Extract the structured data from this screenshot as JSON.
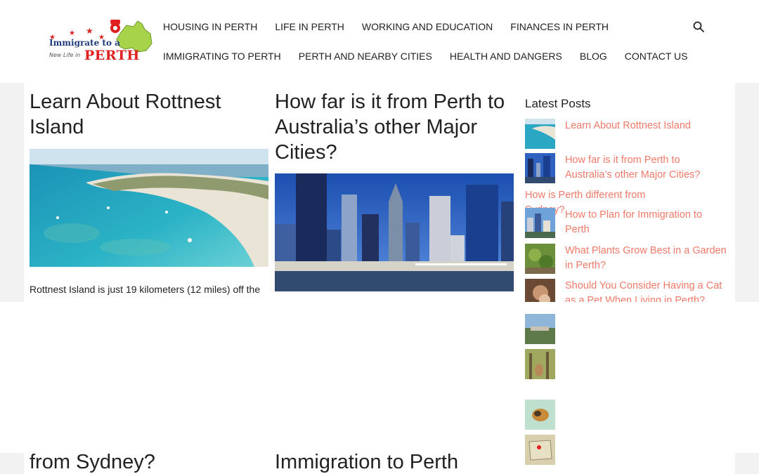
{
  "header": {
    "logo": {
      "line1": "Immigrate to a",
      "line2": "New Life in",
      "perth": "PERTH"
    },
    "nav_row1": [
      "HOUSING IN PERTH",
      "LIFE IN PERTH",
      "WORKING AND EDUCATION",
      "FINANCES IN PERTH"
    ],
    "nav_row2": [
      "IMMIGRATING TO PERTH",
      "PERTH AND NEARBY CITIES",
      "HEALTH AND DANGERS",
      "BLOG",
      "CONTACT US"
    ],
    "search_icon": "search-icon"
  },
  "articles": [
    {
      "title": "Learn About Rottnest Island",
      "excerpt": "Rottnest Island is just 19 kilometers (12 miles) off the",
      "image": "rottnest-island-aerial"
    },
    {
      "title": "How far is it from Perth to Australia’s other Major Cities?",
      "image": "perth-skyline"
    }
  ],
  "bottom_titles": [
    "from Sydney?",
    "Immigration to Perth"
  ],
  "sidebar": {
    "heading": "Latest Posts",
    "posts": [
      {
        "title": "Learn About Rottnest Island",
        "thumb": "rottnest-thumb"
      },
      {
        "title": "How far is it from Perth to Australia’s other Major Cities?",
        "thumb": "skyline-thumb"
      },
      {
        "title": "How is Perth different from Sydney?",
        "thumb": ""
      },
      {
        "title": "How to Plan for Immigration to Perth",
        "thumb": "city-thumb"
      },
      {
        "title": "What Plants Grow Best in a Garden in Perth?",
        "thumb": "garden-thumb"
      },
      {
        "title": "Should You Consider Having a Cat as a Pet When Living in Perth?",
        "thumb": "cat-thumb"
      }
    ]
  },
  "colors": {
    "link": "#f07a6a",
    "text": "#222222",
    "page_bg": "#f2f2f2"
  }
}
